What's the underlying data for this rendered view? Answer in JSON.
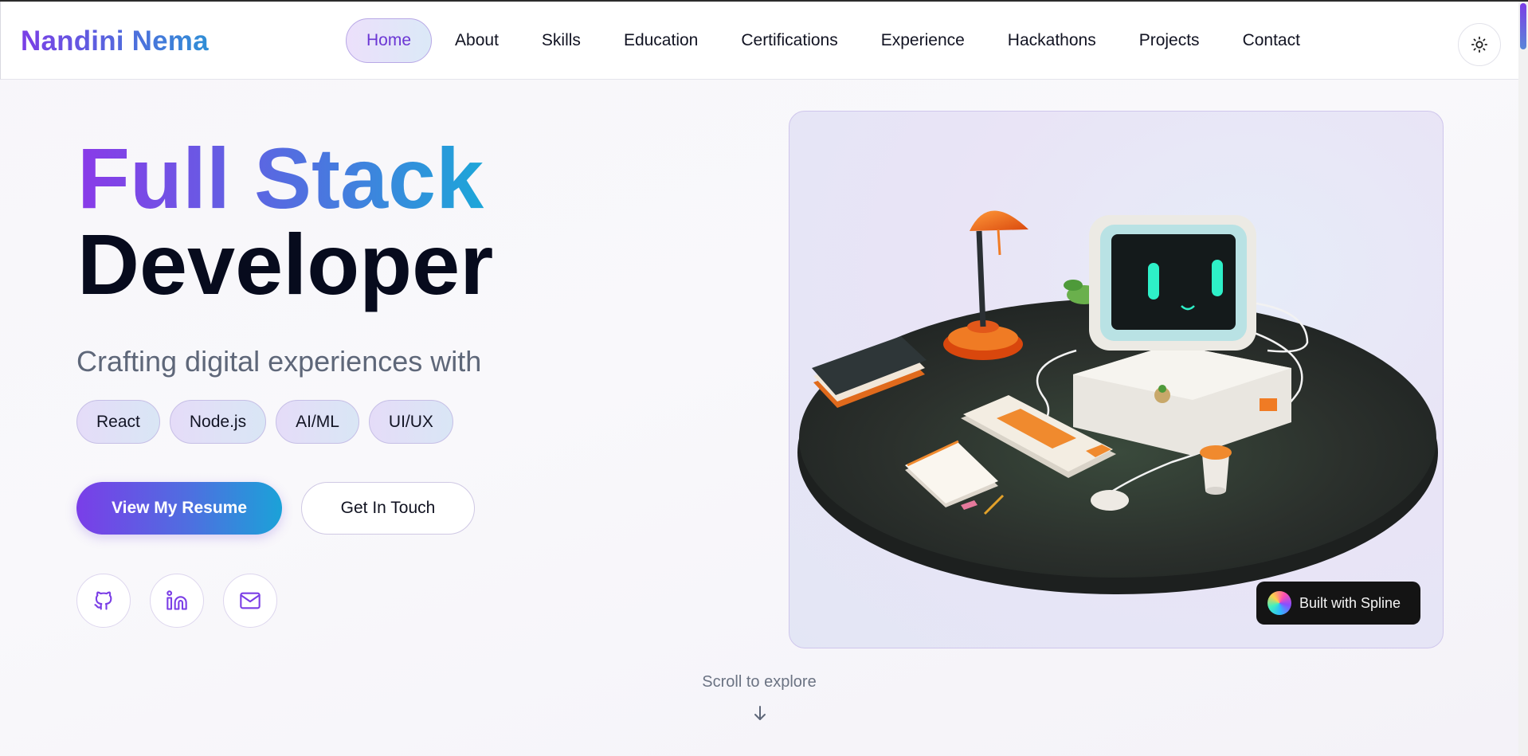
{
  "header": {
    "brand": "Nandini Nema",
    "nav": [
      {
        "label": "Home",
        "active": true
      },
      {
        "label": "About"
      },
      {
        "label": "Skills"
      },
      {
        "label": "Education"
      },
      {
        "label": "Certifications"
      },
      {
        "label": "Experience"
      },
      {
        "label": "Hackathons"
      },
      {
        "label": "Projects"
      },
      {
        "label": "Contact"
      }
    ],
    "theme_toggle_icon": "sun-icon"
  },
  "hero": {
    "title_line1": "Full Stack",
    "title_line2": "Developer",
    "subtitle": "Crafting digital experiences with",
    "chips": [
      "React",
      "Node.js",
      "AI/ML",
      "UI/UX"
    ],
    "primary_button": "View My Resume",
    "secondary_button": "Get In Touch",
    "socials": [
      {
        "icon": "github-icon"
      },
      {
        "icon": "linkedin-icon"
      },
      {
        "icon": "mail-icon"
      }
    ]
  },
  "spline": {
    "badge_label": "Built with Spline"
  },
  "scroll_hint": {
    "label": "Scroll to explore",
    "icon": "arrow-down-icon"
  },
  "colors": {
    "accent_purple": "#7b3ee6",
    "accent_blue": "#1aa9d8",
    "text_dark": "#070b1d"
  }
}
